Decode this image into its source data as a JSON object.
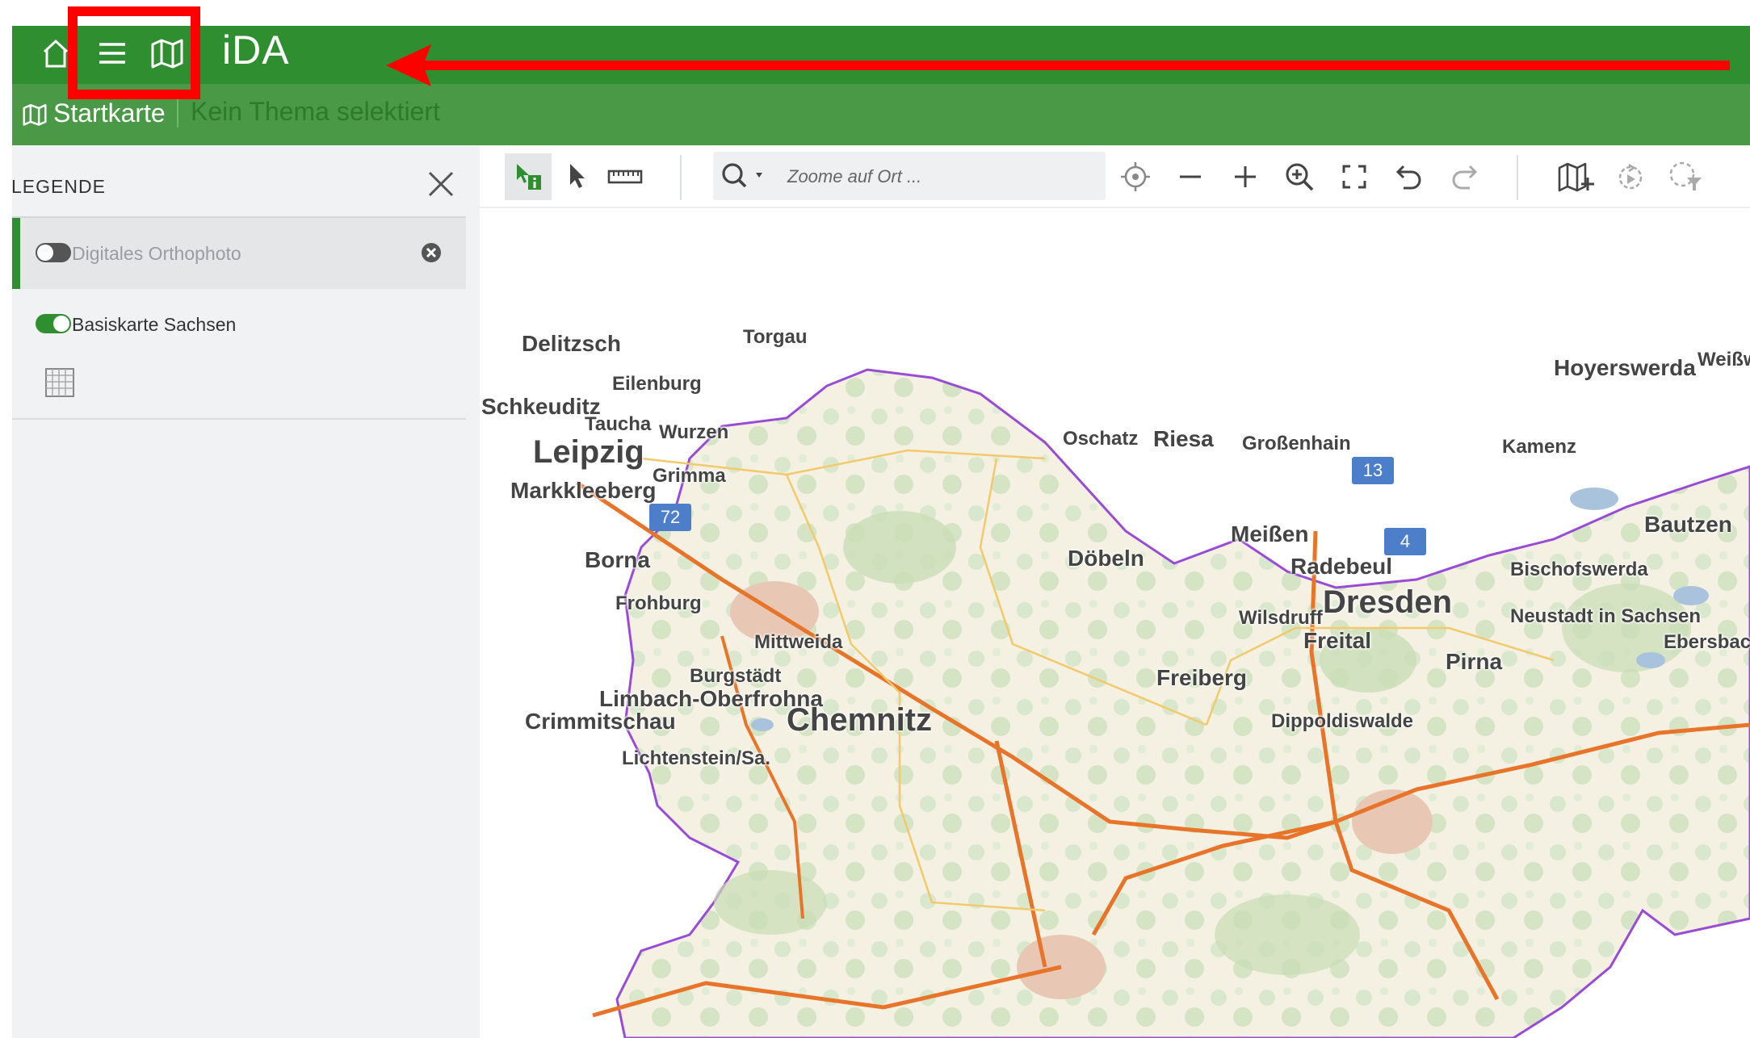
{
  "app": {
    "title": "iDA"
  },
  "header": {
    "icons": [
      "home-icon",
      "menu-icon",
      "map-icon"
    ],
    "breadcrumb_label": "Startkarte",
    "theme_placeholder": "Kein Thema selektiert"
  },
  "legend": {
    "title": "LEGENDE",
    "layers": [
      {
        "label": "Digitales Orthophoto",
        "enabled": false
      },
      {
        "label": "Basiskarte Sachsen",
        "enabled": true
      }
    ]
  },
  "toolbar": {
    "search_placeholder": "Zoome auf Ort ...",
    "tools": [
      "info-select-tool",
      "select-tool",
      "measure-tool",
      "locate",
      "zoom-out",
      "zoom-in",
      "zoom-search",
      "fullscreen",
      "undo",
      "redo",
      "add-map",
      "rotate",
      "filter-select"
    ]
  },
  "map": {
    "cities": [
      "Delitzsch",
      "Torgau",
      "Eilenburg",
      "Schkeuditz",
      "Taucha",
      "Wurzen",
      "Leipzig",
      "Markkleeberg",
      "Oschatz",
      "Riesa",
      "Großenhain",
      "Kamenz",
      "Hoyerswerda",
      "Weißw",
      "Grimma",
      "Borna",
      "Döbeln",
      "Meißen",
      "Radebeul",
      "Bautzen",
      "Bischofswerda",
      "Frohburg",
      "Dresden",
      "Wilsdruff",
      "Freital",
      "Neustadt in Sachsen",
      "Ebersbac",
      "Mittweida",
      "Pirna",
      "Burgstädt",
      "Freiberg",
      "Limbach-Oberfrohna",
      "Chemnitz",
      "Dippoldiswalde",
      "Crimmitschau",
      "Lichtenstein/Sa."
    ],
    "shields": [
      "72",
      "13",
      "4"
    ]
  },
  "colors": {
    "header": "#2f8e2f",
    "subheader": "#4a9947",
    "highlight": "#ff0000"
  }
}
